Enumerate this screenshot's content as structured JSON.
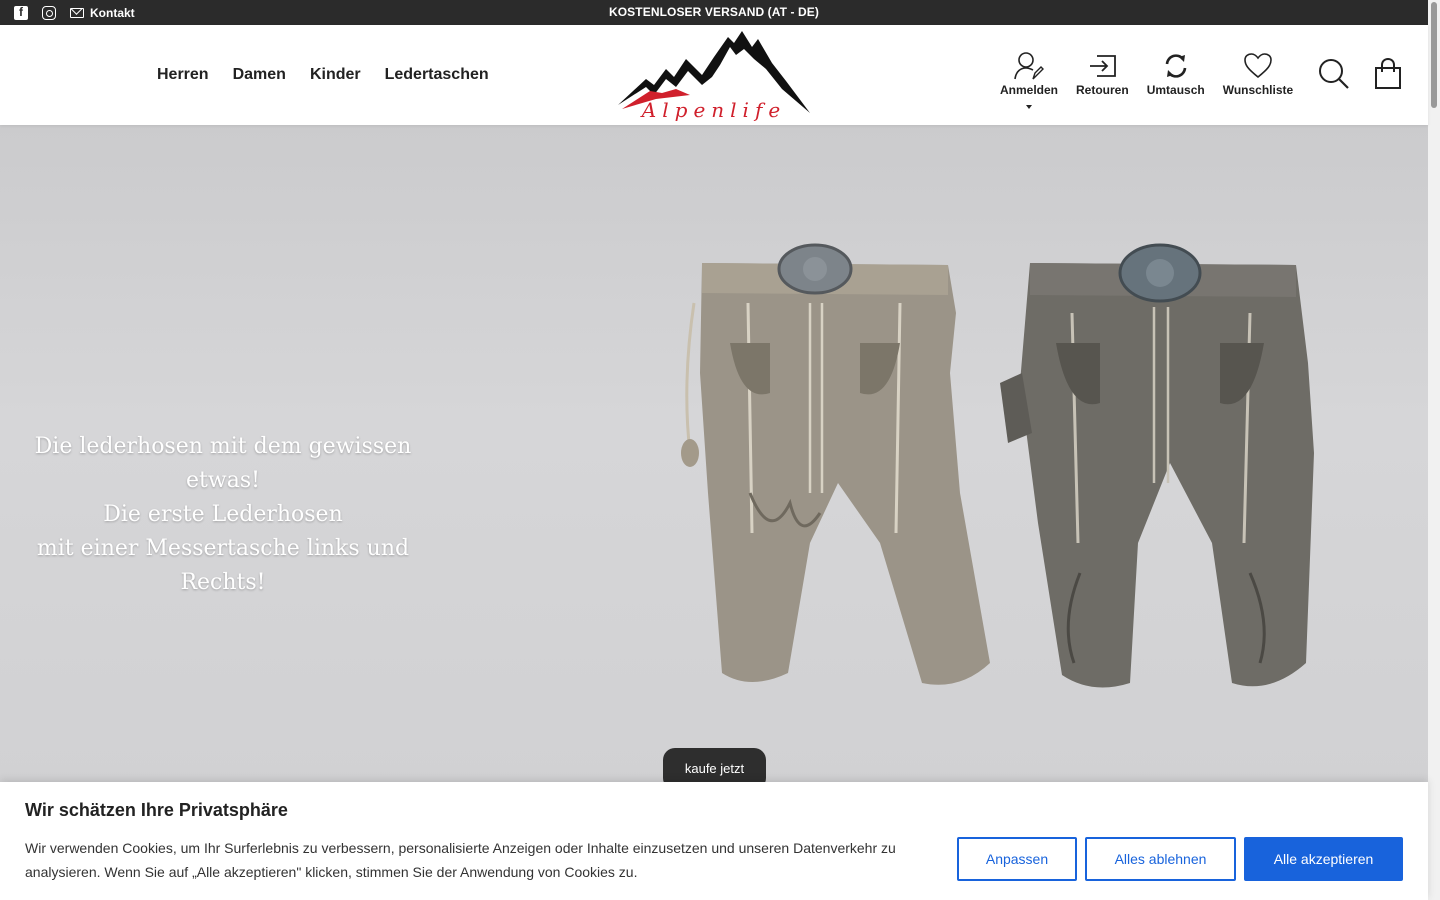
{
  "topbar": {
    "social": [
      "facebook-icon",
      "instagram-icon"
    ],
    "contact_label": "Kontakt",
    "promo": "KOSTENLOSER VERSAND (AT - DE)"
  },
  "nav": {
    "items": [
      {
        "label": "Herren"
      },
      {
        "label": "Damen"
      },
      {
        "label": "Kinder"
      },
      {
        "label": "Ledertaschen"
      }
    ]
  },
  "logo": {
    "text": "Alpenlife"
  },
  "actions": {
    "login": "Anmelden",
    "returns": "Retouren",
    "exchange": "Umtausch",
    "wishlist": "Wunschliste"
  },
  "hero": {
    "line1": "Die lederhosen mit dem gewissen etwas!",
    "line2": "Die erste Lederhosen",
    "line3": "mit einer Messertasche links und Rechts!",
    "cta": "kaufe jetzt"
  },
  "cookie": {
    "title": "Wir schätzen Ihre Privatsphäre",
    "text": "Wir verwenden Cookies, um Ihr Surferlebnis zu verbessern, personalisierte Anzeigen oder Inhalte einzusetzen und unseren Datenverkehr zu analysieren. Wenn Sie auf „Alle akzeptieren\" klicken, stimmen Sie der Anwendung von Cookies zu.",
    "customize": "Anpassen",
    "reject": "Alles ablehnen",
    "accept": "Alle akzeptieren"
  },
  "colors": {
    "topbar": "#2b2b2b",
    "accent_blue": "#1863dc",
    "logo_red": "#d0202c"
  }
}
